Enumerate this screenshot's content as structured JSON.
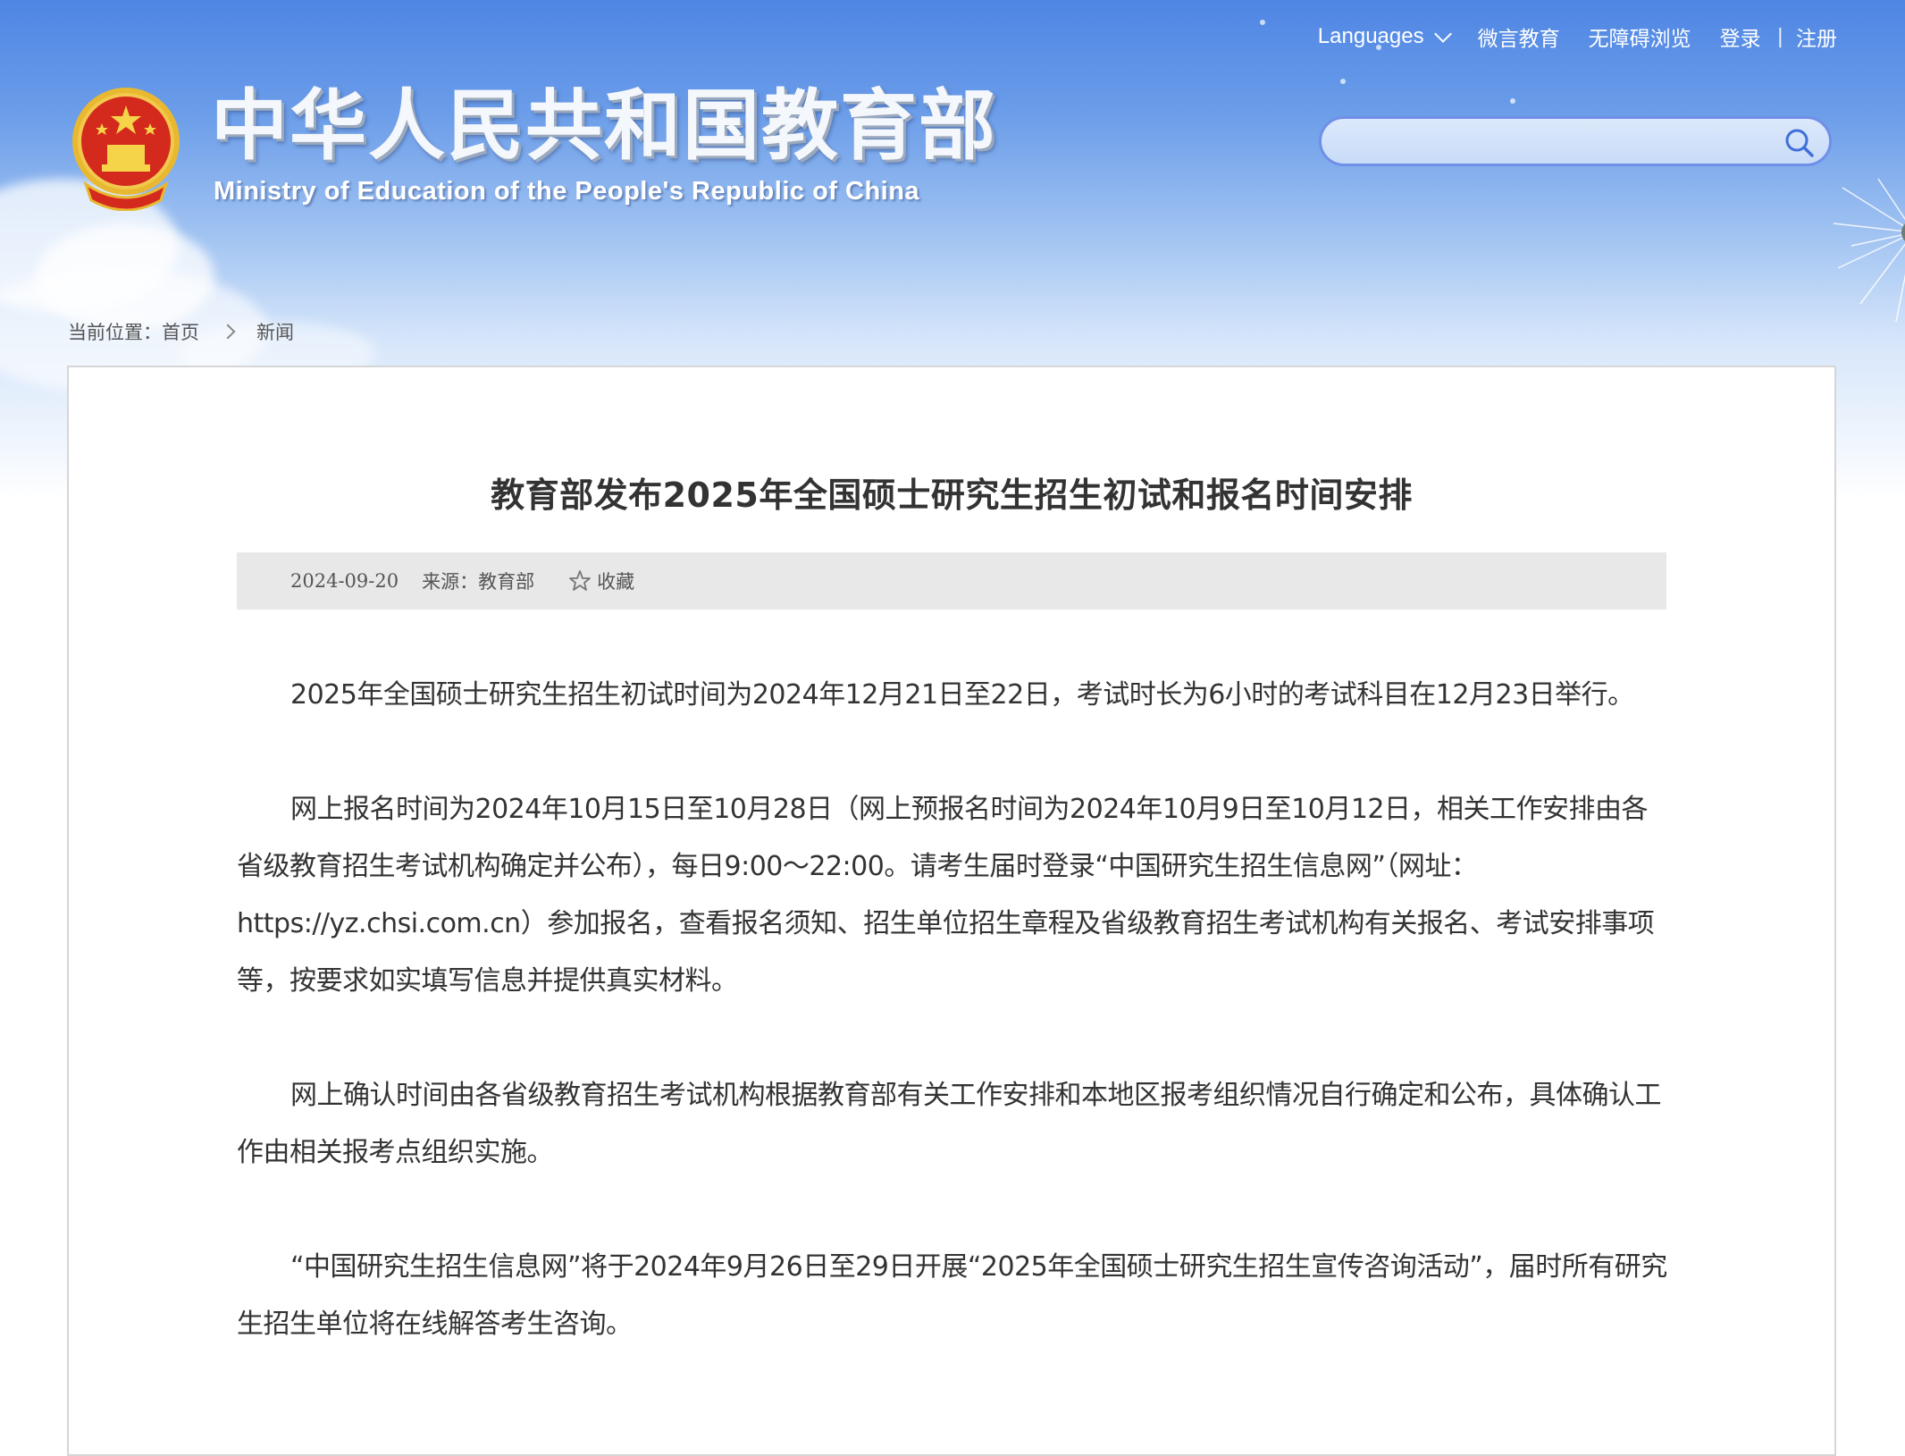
{
  "colors": {
    "sky_top": "#4f86e4",
    "title_text": "#333333",
    "meta_bg": "#e8e8e8",
    "search_border": "#6f8fe8"
  },
  "top_nav": {
    "languages": "Languages",
    "weiyan": "微言教育",
    "accessible": "无障碍浏览",
    "login": "登录",
    "separator": "|",
    "register": "注册"
  },
  "site": {
    "title": "中华人民共和国教育部",
    "subtitle": "Ministry of Education of the People's Republic of China",
    "emblem_icon": "national-emblem-icon"
  },
  "search": {
    "placeholder": "",
    "value": "",
    "icon": "search-icon"
  },
  "breadcrumb": {
    "prefix": "当前位置：",
    "home": "首页",
    "current": "新闻"
  },
  "article": {
    "title": "教育部发布2025年全国硕士研究生招生初试和报名时间安排",
    "date": "2024-09-20",
    "source": "来源：教育部",
    "favorite": "收藏",
    "paragraphs": [
      "2025年全国硕士研究生招生初试时间为2024年12月21日至22日，考试时长为6小时的考试科目在12月23日举行。",
      "网上报名时间为2024年10月15日至10月28日（网上预报名时间为2024年10月9日至10月12日，相关工作安排由各省级教育招生考试机构确定并公布），每日9:00～22:00。请考生届时登录“中国研究生招生信息网”（网址：https://yz.chsi.com.cn）参加报名，查看报名须知、招生单位招生章程及省级教育招生考试机构有关报名、考试安排事项等，按要求如实填写信息并提供真实材料。",
      "网上确认时间由各省级教育招生考试机构根据教育部有关工作安排和本地区报考组织情况自行确定和公布，具体确认工作由相关报考点组织实施。",
      "“中国研究生招生信息网”将于2024年9月26日至29日开展“2025年全国硕士研究生招生宣传咨询活动”，届时所有研究生招生单位将在线解答考生咨询。"
    ]
  }
}
